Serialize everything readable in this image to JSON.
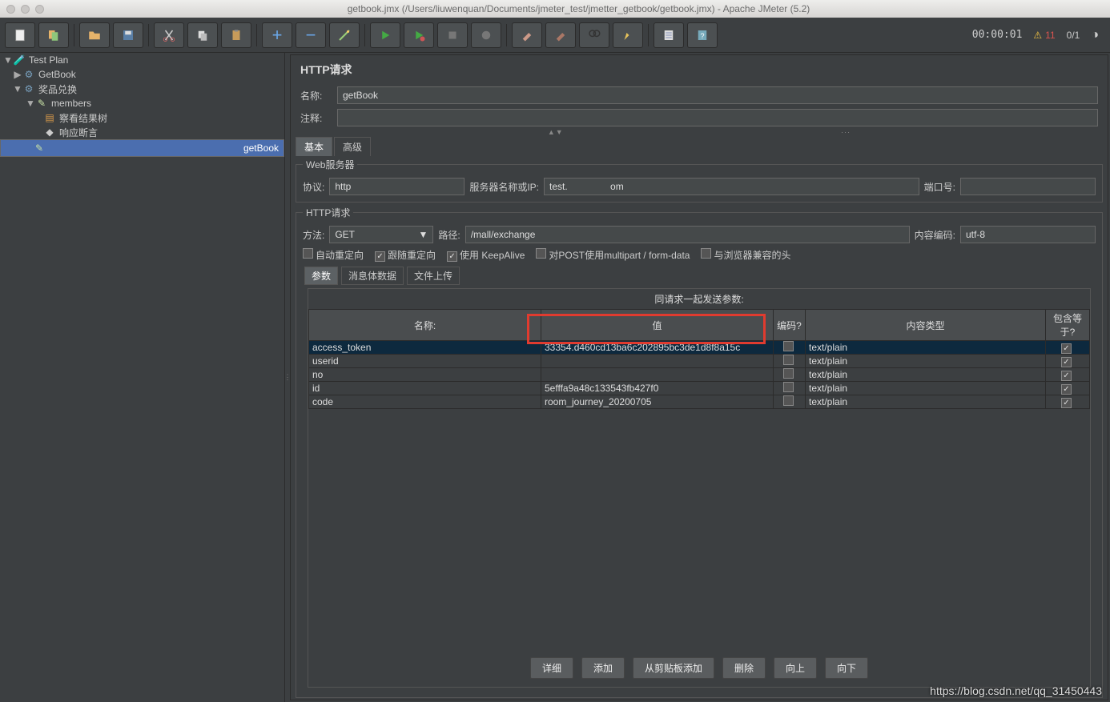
{
  "window": {
    "title": "getbook.jmx (/Users/liuwenquan/Documents/jmeter_test/jmetter_getbook/getbook.jmx) - Apache JMeter (5.2)"
  },
  "toolbar": {
    "timer": "00:00:01",
    "warn_count": "11",
    "run_count": "0/1"
  },
  "tree": {
    "root": "Test Plan",
    "n1": "GetBook",
    "n2": "奖品兑换",
    "n3": "members",
    "n4": "察看结果树",
    "n5": "响应断言",
    "n6": "getBook"
  },
  "panel": {
    "title": "HTTP请求",
    "name_label": "名称:",
    "name_value": "getBook",
    "comment_label": "注释:",
    "comment_value": "",
    "tab_basic": "基本",
    "tab_adv": "高级",
    "ws_legend": "Web服务器",
    "proto_label": "协议:",
    "proto_value": "http",
    "server_label": "服务器名称或IP:",
    "server_value": "test.                om",
    "port_label": "端口号:",
    "port_value": "",
    "http_legend": "HTTP请求",
    "method_label": "方法:",
    "method_value": "GET",
    "path_label": "路径:",
    "path_value": "/mall/exchange",
    "enc_label": "内容编码:",
    "enc_value": "utf-8",
    "cb_autoredir": "自动重定向",
    "cb_follow": "跟随重定向",
    "cb_keepalive": "使用 KeepAlive",
    "cb_multipart": "对POST使用multipart / form-data",
    "cb_browser": "与浏览器兼容的头",
    "ptab_params": "参数",
    "ptab_body": "消息体数据",
    "ptab_files": "文件上传",
    "param_caption": "同请求一起发送参数:",
    "cols": {
      "name": "名称:",
      "value": "值",
      "encode": "编码?",
      "ctype": "内容类型",
      "equals": "包含等于?"
    },
    "rows": [
      {
        "name": "access_token",
        "value": "33354.d460cd13ba6c202895bc3de1d8f8a15c",
        "encode": false,
        "ctype": "text/plain",
        "equals": true
      },
      {
        "name": "userid",
        "value": "",
        "encode": false,
        "ctype": "text/plain",
        "equals": true
      },
      {
        "name": "no",
        "value": "",
        "encode": false,
        "ctype": "text/plain",
        "equals": true
      },
      {
        "name": "id",
        "value": "5efffa9a48c133543fb427f0",
        "encode": false,
        "ctype": "text/plain",
        "equals": true
      },
      {
        "name": "code",
        "value": "room_journey_20200705",
        "encode": false,
        "ctype": "text/plain",
        "equals": true
      }
    ],
    "btns": {
      "detail": "详细",
      "add": "添加",
      "paste": "从剪贴板添加",
      "del": "删除",
      "up": "向上",
      "down": "向下"
    }
  },
  "watermark": "https://blog.csdn.net/qq_31450443"
}
